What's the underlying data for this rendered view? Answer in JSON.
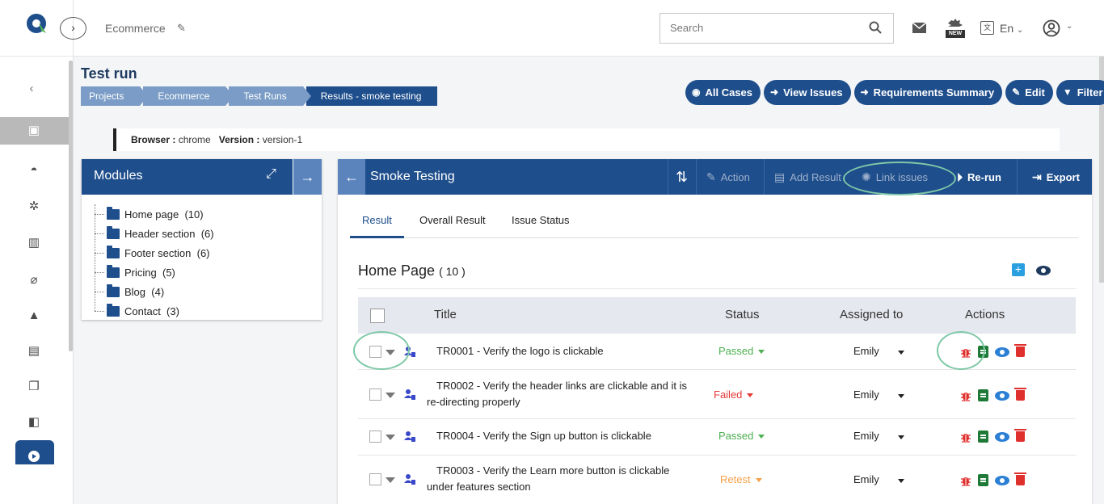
{
  "header": {
    "project_name": "Ecommerce",
    "search_placeholder": "Search",
    "language": "En",
    "new_badge": "NEW"
  },
  "page": {
    "title": "Test run",
    "breadcrumbs": [
      "Projects",
      "Ecommerce",
      "Test Runs",
      "Results - smoke testing"
    ]
  },
  "actions": {
    "all_cases": "All Cases",
    "view_issues": "View Issues",
    "requirements_summary": "Requirements Summary",
    "edit": "Edit",
    "filter": "Filter"
  },
  "browser_info": {
    "browser_label": "Browser :",
    "browser_value": "chrome",
    "version_label": "Version :",
    "version_value": "version-1"
  },
  "modules": {
    "title": "Modules",
    "items": [
      {
        "name": "Home page",
        "count": "(10)"
      },
      {
        "name": "Header section",
        "count": "(6)"
      },
      {
        "name": "Footer section",
        "count": "(6)"
      },
      {
        "name": "Pricing",
        "count": "(5)"
      },
      {
        "name": "Blog",
        "count": "(4)"
      },
      {
        "name": "Contact",
        "count": "(3)"
      }
    ]
  },
  "panel": {
    "title": "Smoke Testing",
    "tools": {
      "action": "Action",
      "add_result": "Add Result",
      "link_issues": "Link issues",
      "rerun": "Re-run",
      "export": "Export"
    },
    "tabs": [
      "Result",
      "Overall Result",
      "Issue Status"
    ],
    "section_title": "Home Page",
    "section_count": "( 10 )",
    "columns": {
      "title": "Title",
      "status": "Status",
      "assigned": "Assigned to",
      "actions": "Actions"
    },
    "rows": [
      {
        "title": "TR0001 - Verify the logo is clickable",
        "status": "Passed",
        "assigned": "Emily"
      },
      {
        "title": "TR0002 - Verify the header links are clickable and it is re-directing properly",
        "status": "Failed",
        "assigned": "Emily"
      },
      {
        "title": "TR0004 - Verify the Sign up button is clickable",
        "status": "Passed",
        "assigned": "Emily"
      },
      {
        "title": "TR0003 - Verify the Learn more button is clickable under features section",
        "status": "Retest",
        "assigned": "Emily"
      }
    ]
  },
  "colors": {
    "primary": "#1e4e8c",
    "breadcrumb_light": "#7a9cc6",
    "passed": "#4caf50",
    "failed": "#e53935",
    "retest": "#f5a04a",
    "highlight_ring": "#7fc9a8"
  }
}
